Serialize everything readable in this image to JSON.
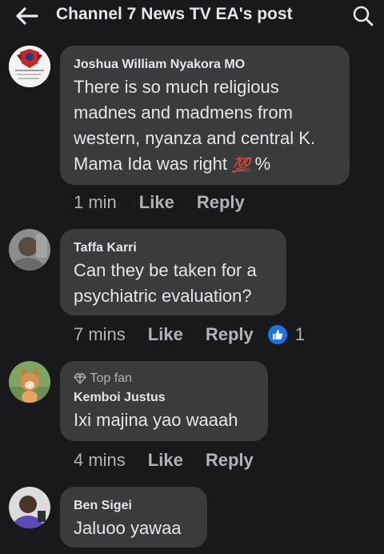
{
  "header": {
    "title": "Channel 7 News TV EA's post",
    "back_icon": "arrow-left-icon",
    "search_icon": "search-icon"
  },
  "comments": [
    {
      "name": "Joshua William Nyakora MO",
      "text": "There is so much religious madnes and madmens from western, nyanza and central K. Mama Ida was right",
      "emoji": "💯",
      "suffix": "%",
      "time": "1 min",
      "like_label": "Like",
      "reply_label": "Reply"
    },
    {
      "name": "Taffa Karri",
      "text": "Can they be taken for a psychiatric evaluation?",
      "time": "7 mins",
      "like_label": "Like",
      "reply_label": "Reply",
      "reaction_count": "1"
    },
    {
      "badge": "Top fan",
      "name": "Kemboi Justus",
      "text": "Ixi majina yao waaah",
      "time": "4 mins",
      "like_label": "Like",
      "reply_label": "Reply"
    },
    {
      "name": "Ben Sigei",
      "text": "Jaluoo yawaa"
    }
  ],
  "colors": {
    "background": "#18191a",
    "bubble": "#3a3b3c",
    "text": "#e4e6eb",
    "secondary": "#b0b3b8",
    "like_blue": "#1b74e4"
  }
}
